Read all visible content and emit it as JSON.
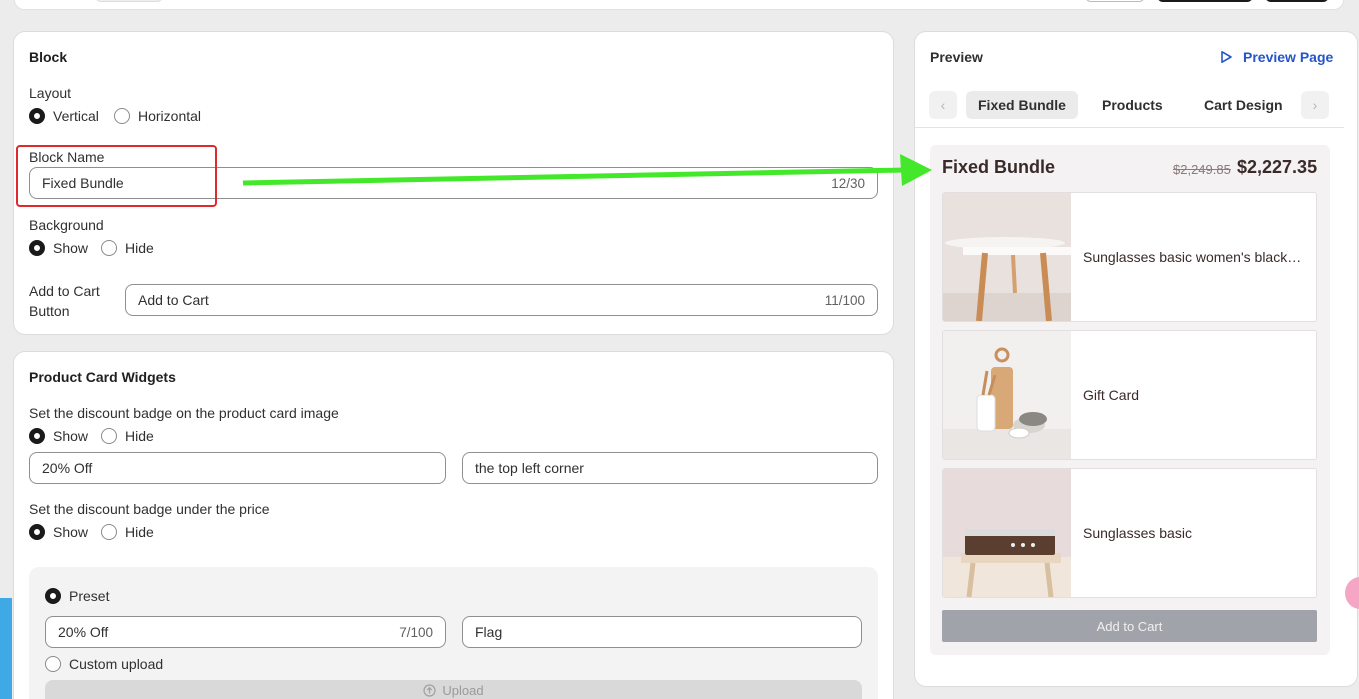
{
  "block": {
    "title": "Block",
    "layout": {
      "label": "Layout",
      "options": [
        "Vertical",
        "Horizontal"
      ]
    },
    "block_name": {
      "label": "Block Name",
      "value": "Fixed Bundle",
      "count": "12/30"
    },
    "background": {
      "label": "Background",
      "options": [
        "Show",
        "Hide"
      ]
    },
    "add_to_cart": {
      "label_line1": "Add to Cart",
      "label_line2": "Button",
      "value": "Add to Cart",
      "count": "11/100"
    }
  },
  "widgets": {
    "title": "Product Card Widgets",
    "badge_image": {
      "label": "Set the discount badge on the product card image",
      "options": [
        "Show",
        "Hide"
      ],
      "text_value": "20% Off",
      "position_value": "the top left corner"
    },
    "badge_price": {
      "label": "Set the discount badge under the price",
      "options": [
        "Show",
        "Hide"
      ]
    },
    "preset": {
      "label": "Preset",
      "text_value": "20% Off",
      "count": "7/100",
      "style_value": "Flag"
    },
    "custom_upload": {
      "label": "Custom upload",
      "upload_label": "Upload"
    }
  },
  "preview": {
    "title": "Preview",
    "link_label": "Preview Page",
    "tabs": [
      "Fixed Bundle",
      "Products",
      "Cart Design"
    ],
    "bundle_title": "Fixed Bundle",
    "old_price": "$2,249.85",
    "new_price": "$2,227.35",
    "products": [
      {
        "name": "Sunglasses basic women's black…"
      },
      {
        "name": "Gift Card"
      },
      {
        "name": "Sunglasses basic"
      }
    ],
    "add_to_cart_label": "Add to Cart"
  },
  "colors": {
    "highlight": "#e0292c",
    "arrow": "#44e82a",
    "link": "#2455c9",
    "addcart": "#a0a3a9"
  }
}
